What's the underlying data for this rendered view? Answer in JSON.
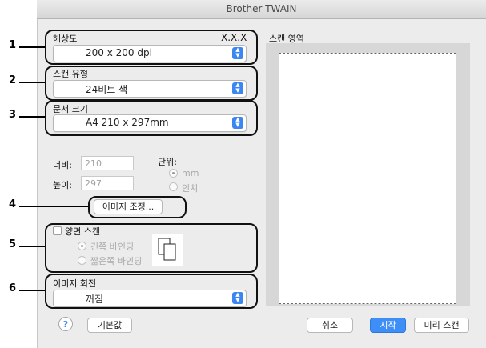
{
  "window": {
    "title": "Brother TWAIN"
  },
  "callouts": [
    "1",
    "2",
    "3",
    "4",
    "5",
    "6"
  ],
  "resolution": {
    "label": "해상도",
    "version": "X.X.X",
    "value": "200 x 200 dpi"
  },
  "scan_type": {
    "label": "스캔 유형",
    "value": "24비트 색"
  },
  "document_size": {
    "label": "문서 크기",
    "value": "A4  210 x 297mm"
  },
  "dimensions": {
    "width_label": "너비:",
    "width_value": "210",
    "height_label": "높이:",
    "height_value": "297",
    "unit_label": "단위:",
    "unit_mm": "mm",
    "unit_inch": "인치"
  },
  "image_adjust_button": "이미지 조정...",
  "duplex": {
    "label": "양면 스캔",
    "long_edge": "긴쪽 바인딩",
    "short_edge": "짧은쪽 바인딩"
  },
  "rotation": {
    "label": "이미지 회전",
    "value": "꺼짐"
  },
  "scan_area": {
    "label": "스캔 영역"
  },
  "buttons": {
    "help": "?",
    "default": "기본값",
    "cancel": "취소",
    "start": "시작",
    "prescan": "미리 스캔"
  },
  "colors": {
    "accent": "#3d8ef7",
    "window_bg": "#ececec"
  }
}
